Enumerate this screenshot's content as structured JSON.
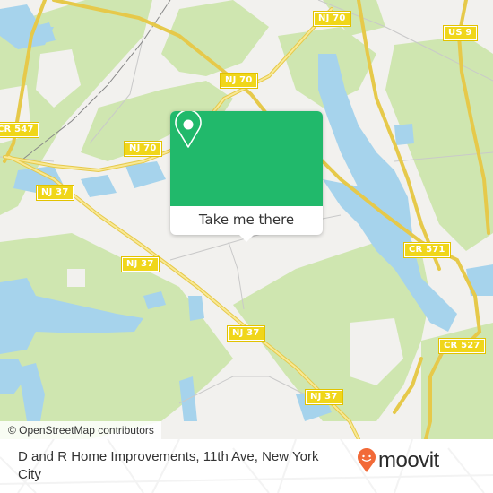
{
  "map": {
    "road_labels": [
      {
        "id": "nj70-top",
        "text": "NJ 70"
      },
      {
        "id": "us9",
        "text": "US 9"
      },
      {
        "id": "cr547",
        "text": "CR 547"
      },
      {
        "id": "nj70-mid",
        "text": "NJ 70"
      },
      {
        "id": "nj70-left",
        "text": "NJ 70"
      },
      {
        "id": "nj37-left",
        "text": "NJ 37"
      },
      {
        "id": "nj37-mid",
        "text": "NJ 37"
      },
      {
        "id": "cr571",
        "text": "CR 571"
      },
      {
        "id": "nj37-center",
        "text": "NJ 37"
      },
      {
        "id": "cr527",
        "text": "CR 527"
      },
      {
        "id": "nj37-bottom",
        "text": "NJ 37"
      }
    ],
    "attribution": "© OpenStreetMap contributors",
    "colors": {
      "land": "#f2f1ee",
      "forest": "#cfe6b0",
      "water": "#a6d3ec",
      "road": "#f4de6e",
      "accent": "#21b96b"
    }
  },
  "popup": {
    "icon": "location-pin-icon",
    "button_label": "Take me there"
  },
  "footer": {
    "title": "D and R Home Improvements, 11th Ave, New York City",
    "brand": "moovit",
    "brand_color": "#f26a38"
  }
}
